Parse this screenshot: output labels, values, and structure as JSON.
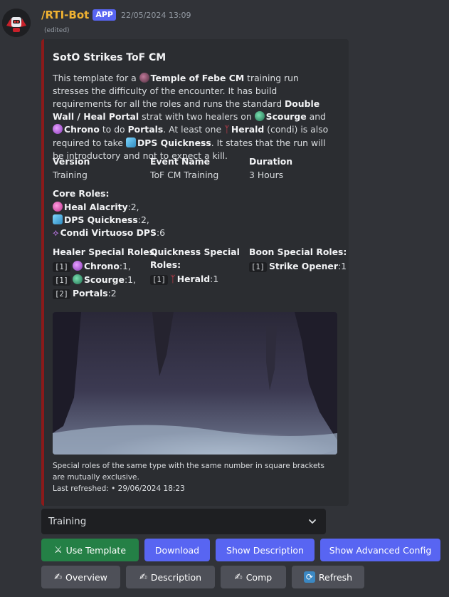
{
  "message": {
    "bot_name": "/RTI-Bot",
    "badge": "APP",
    "timestamp": "22/05/2024 13:09",
    "edited": "(edited)"
  },
  "embed": {
    "accent_color": "#8b1a1a",
    "title": "SotO Strikes ToF CM",
    "description": {
      "t1": "This template for a ",
      "b1": "Temple of Febe CM",
      "t2": " training run stresses the difficulty of the encounter. It has build requirements for all the roles and runs the standard ",
      "b2": "Double Wall / Heal Portal",
      "t3": " strat with two healers on ",
      "b3": "Scourge",
      "t4": " and ",
      "b4": "Chrono",
      "t5": " to do ",
      "b5": "Portals",
      "t6": ". At least one ",
      "b6": "Herald",
      "t7": " (condi) is also required to take ",
      "b7": "DPS Quickness",
      "t8": ". It states that the run will be introductory and not to expect a kill."
    },
    "fields": {
      "version": {
        "name": "Version",
        "value": "Training"
      },
      "event_name": {
        "name": "Event Name",
        "value": "ToF CM Training"
      },
      "duration": {
        "name": "Duration",
        "value": "3 Hours"
      },
      "core_roles": {
        "name": "Core Roles:",
        "items": [
          {
            "label": "Heal Alacrity",
            "count": ":2,",
            "icon": "heal-alacrity-icon"
          },
          {
            "label": "DPS Quickness",
            "count": ":2,",
            "icon": "quickness-icon"
          },
          {
            "label": "Condi Virtuoso DPS",
            "count": ":6",
            "icon": "virtuoso-icon"
          }
        ]
      },
      "healer_special": {
        "name": "Healer Special Roles:",
        "items": [
          {
            "code": "[1]",
            "label": "Chrono",
            "count": ":1,"
          },
          {
            "code": "[1]",
            "label": "Scourge",
            "count": ":1,"
          },
          {
            "code": "[2]",
            "label": "Portals",
            "count": ":2"
          }
        ]
      },
      "quickness_special": {
        "name_l1": "Quickness Special",
        "name_l2": "Roles:",
        "items": [
          {
            "code": "[1]",
            "label": "Herald",
            "count": ":1"
          }
        ]
      },
      "boon_special": {
        "name": "Boon Special Roles:",
        "items": [
          {
            "code": "[1]",
            "label": "Strike Opener",
            "count": ":1"
          }
        ]
      }
    },
    "footer": {
      "line1": "Special roles of the same type with the same number in square brackets are mutually exclusive.",
      "line2": "Last refreshed: • 29/06/2024 18:23"
    }
  },
  "select": {
    "value": "Training"
  },
  "buttons": {
    "use_template": "Use Template",
    "download": "Download",
    "show_description": "Show Description",
    "show_advanced_config": "Show Advanced Config",
    "overview": "Overview",
    "description": "Description",
    "comp": "Comp",
    "refresh": "Refresh"
  },
  "colors": {
    "green": "#248046",
    "blurple": "#5865f2",
    "grey": "#4e5058",
    "bot_name": "#f0b232"
  }
}
